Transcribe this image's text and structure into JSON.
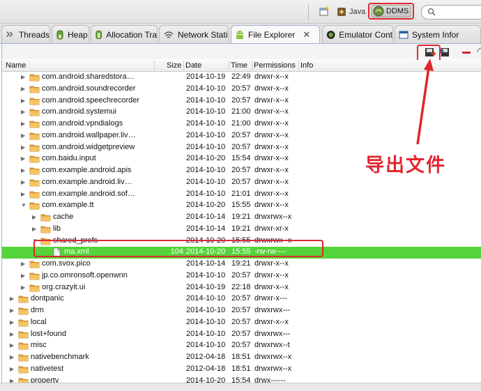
{
  "toolbar": {
    "java_label": "Java",
    "ddms_label": "DDMS",
    "search_placeholder": ""
  },
  "tabs": [
    {
      "label": "Threads",
      "icon": "threads-icon"
    },
    {
      "label": "Heap",
      "icon": "heap-icon"
    },
    {
      "label": "Allocation Tra",
      "icon": "allocation-icon"
    },
    {
      "label": "Network Stati",
      "icon": "network-icon"
    },
    {
      "label": "File Explorer",
      "icon": "android-icon",
      "active": true
    },
    {
      "label": "Emulator Cont",
      "icon": "emulator-icon"
    },
    {
      "label": "System Infor",
      "icon": "system-info-icon"
    }
  ],
  "columns": {
    "name": "Name",
    "size": "Size",
    "date": "Date",
    "time": "Time",
    "permissions": "Permissions",
    "info": "Info"
  },
  "rows": [
    {
      "name": "com.android.sharedstora…",
      "size": "",
      "date": "2014-10-19",
      "time": "22:49",
      "perm": "drwxr-x--x",
      "level": 2,
      "type": "folder",
      "expanded": false
    },
    {
      "name": "com.android.soundrecorder",
      "size": "",
      "date": "2014-10-10",
      "time": "20:57",
      "perm": "drwxr-x--x",
      "level": 2,
      "type": "folder",
      "expanded": false
    },
    {
      "name": "com.android.speechrecorder",
      "size": "",
      "date": "2014-10-10",
      "time": "20:57",
      "perm": "drwxr-x--x",
      "level": 2,
      "type": "folder",
      "expanded": false
    },
    {
      "name": "com.android.systemui",
      "size": "",
      "date": "2014-10-10",
      "time": "21:00",
      "perm": "drwxr-x--x",
      "level": 2,
      "type": "folder",
      "expanded": false
    },
    {
      "name": "com.android.vpndialogs",
      "size": "",
      "date": "2014-10-10",
      "time": "21:00",
      "perm": "drwxr-x--x",
      "level": 2,
      "type": "folder",
      "expanded": false
    },
    {
      "name": "com.android.wallpaper.liv…",
      "size": "",
      "date": "2014-10-10",
      "time": "20:57",
      "perm": "drwxr-x--x",
      "level": 2,
      "type": "folder",
      "expanded": false
    },
    {
      "name": "com.android.widgetpreview",
      "size": "",
      "date": "2014-10-10",
      "time": "20:57",
      "perm": "drwxr-x--x",
      "level": 2,
      "type": "folder",
      "expanded": false
    },
    {
      "name": "com.baidu.input",
      "size": "",
      "date": "2014-10-20",
      "time": "15:54",
      "perm": "drwxr-x--x",
      "level": 2,
      "type": "folder",
      "expanded": false
    },
    {
      "name": "com.example.android.apis",
      "size": "",
      "date": "2014-10-10",
      "time": "20:57",
      "perm": "drwxr-x--x",
      "level": 2,
      "type": "folder",
      "expanded": false
    },
    {
      "name": "com.example.android.liv…",
      "size": "",
      "date": "2014-10-10",
      "time": "20:57",
      "perm": "drwxr-x--x",
      "level": 2,
      "type": "folder",
      "expanded": false
    },
    {
      "name": "com.example.android.sof…",
      "size": "",
      "date": "2014-10-10",
      "time": "21:01",
      "perm": "drwxr-x--x",
      "level": 2,
      "type": "folder",
      "expanded": false
    },
    {
      "name": "com.example.tt",
      "size": "",
      "date": "2014-10-20",
      "time": "15:55",
      "perm": "drwxr-x--x",
      "level": 2,
      "type": "folder",
      "expanded": true
    },
    {
      "name": "cache",
      "size": "",
      "date": "2014-10-14",
      "time": "19:21",
      "perm": "drwxrwx--x",
      "level": 3,
      "type": "folder",
      "expanded": false
    },
    {
      "name": "lib",
      "size": "",
      "date": "2014-10-14",
      "time": "19:21",
      "perm": "drwxr-xr-x",
      "level": 3,
      "type": "folder",
      "expanded": false
    },
    {
      "name": "shared_prefs",
      "size": "",
      "date": "2014-10-20",
      "time": "15:55",
      "perm": "drwxrwx--x",
      "level": 3,
      "type": "folder",
      "expanded": true
    },
    {
      "name": "ma.xml",
      "size": "104",
      "date": "2014-10-20",
      "time": "15:55",
      "perm": "-rw-rw----",
      "level": 4,
      "type": "file",
      "selected": true
    },
    {
      "name": "com.svox.pico",
      "size": "",
      "date": "2014-10-14",
      "time": "19:21",
      "perm": "drwxr-x--x",
      "level": 2,
      "type": "folder",
      "expanded": false
    },
    {
      "name": "jp.co.omronsoft.openwnn",
      "size": "",
      "date": "2014-10-10",
      "time": "20:57",
      "perm": "drwxr-x--x",
      "level": 2,
      "type": "folder",
      "expanded": false
    },
    {
      "name": "org.crazyit.ui",
      "size": "",
      "date": "2014-10-19",
      "time": "22:18",
      "perm": "drwxr-x--x",
      "level": 2,
      "type": "folder",
      "expanded": false
    },
    {
      "name": "dontpanic",
      "size": "",
      "date": "2014-10-10",
      "time": "20:57",
      "perm": "drwxr-x---",
      "level": 1,
      "type": "folder",
      "expanded": false
    },
    {
      "name": "drm",
      "size": "",
      "date": "2014-10-10",
      "time": "20:57",
      "perm": "drwxrwx---",
      "level": 1,
      "type": "folder",
      "expanded": false
    },
    {
      "name": "local",
      "size": "",
      "date": "2014-10-10",
      "time": "20:57",
      "perm": "drwxr-x--x",
      "level": 1,
      "type": "folder",
      "expanded": false
    },
    {
      "name": "lost+found",
      "size": "",
      "date": "2014-10-10",
      "time": "20:57",
      "perm": "drwxrwx---",
      "level": 1,
      "type": "folder",
      "expanded": false
    },
    {
      "name": "misc",
      "size": "",
      "date": "2014-10-10",
      "time": "20:57",
      "perm": "drwxrwx--t",
      "level": 1,
      "type": "folder",
      "expanded": false
    },
    {
      "name": "nativebenchmark",
      "size": "",
      "date": "2012-04-18",
      "time": "18:51",
      "perm": "drwxrwx--x",
      "level": 1,
      "type": "folder",
      "expanded": false
    },
    {
      "name": "nativetest",
      "size": "",
      "date": "2012-04-18",
      "time": "18:51",
      "perm": "drwxrwx--x",
      "level": 1,
      "type": "folder",
      "expanded": false
    },
    {
      "name": "property",
      "size": "",
      "date": "2014-10-20",
      "time": "15:54",
      "perm": "drwx------",
      "level": 1,
      "type": "folder",
      "expanded": false
    }
  ],
  "annotation": {
    "label": "导出文件"
  },
  "colors": {
    "selection": "#55d33a",
    "annotation_red": "#e0262f",
    "folder": "#e8a23a"
  }
}
